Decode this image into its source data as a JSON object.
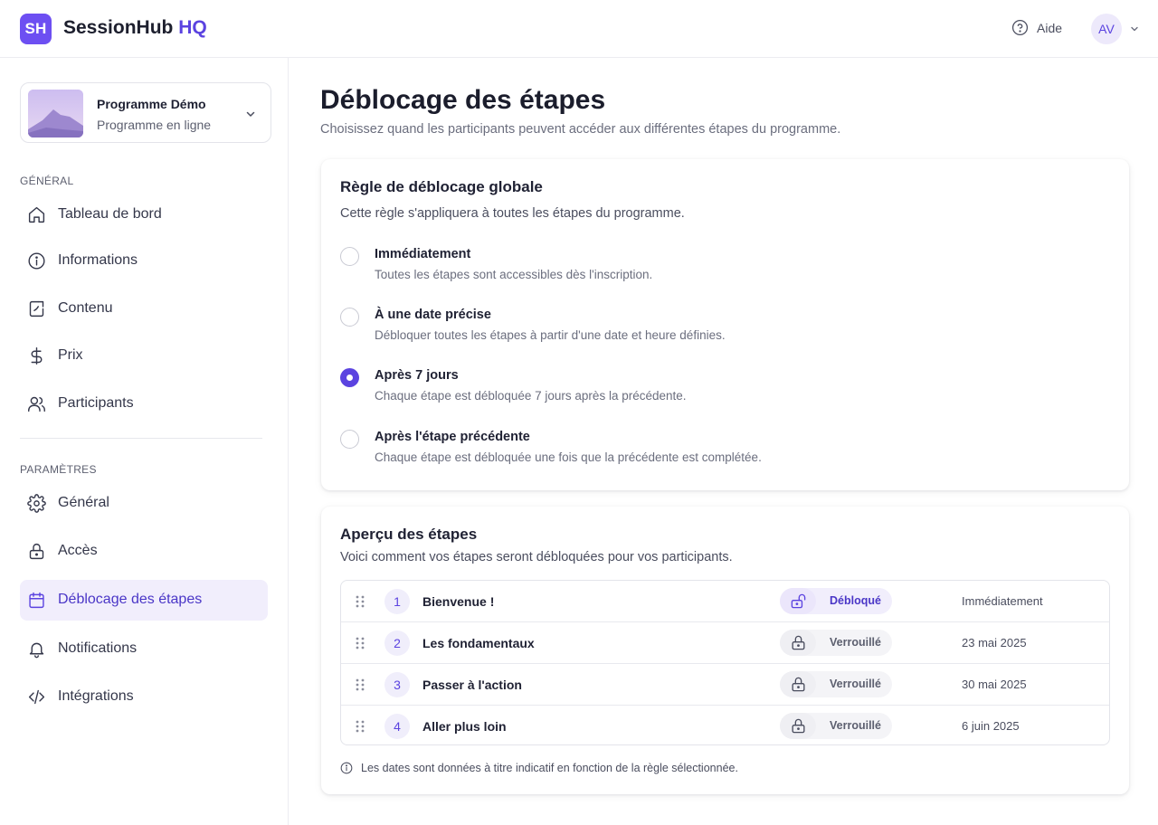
{
  "app": {
    "logo_mark": "SH",
    "name_main": "SessionHub",
    "name_accent": "HQ",
    "accent_color": "#5b43e0"
  },
  "header": {
    "help_label": "Aide",
    "help_icon": "help-circle-icon",
    "avatar_initials": "AV"
  },
  "sidebar": {
    "program": {
      "name": "Programme Démo",
      "subtitle": "Programme en ligne"
    },
    "general_section": "GÉNÉRAL",
    "general_items": [
      {
        "label": "Tableau de bord",
        "icon": "home-icon"
      },
      {
        "label": "Informations",
        "icon": "info-icon"
      },
      {
        "label": "Contenu",
        "icon": "content-icon"
      },
      {
        "label": "Prix",
        "icon": "dollar-icon"
      },
      {
        "label": "Participants",
        "icon": "users-icon"
      }
    ],
    "settings_section": "PARAMÈTRES",
    "settings_items": [
      {
        "label": "Général",
        "icon": "gear-icon"
      },
      {
        "label": "Accès",
        "icon": "lock-icon"
      },
      {
        "label": "Déblocage des étapes",
        "icon": "calendar-icon",
        "active": true
      },
      {
        "label": "Notifications",
        "icon": "bell-icon"
      },
      {
        "label": "Intégrations",
        "icon": "code-icon"
      }
    ]
  },
  "main": {
    "title": "Déblocage des étapes",
    "subtitle": "Choisissez quand les participants peuvent accéder aux différentes étapes du programme.",
    "rule_card": {
      "title": "Règle de déblocage globale",
      "subtitle": "Cette règle s'appliquera à toutes les étapes du programme.",
      "options": [
        {
          "title": "Immédiatement",
          "desc": "Toutes les étapes sont accessibles dès l'inscription.",
          "selected": false
        },
        {
          "title": "À une date précise",
          "desc": "Débloquer toutes les étapes à partir d'une date et heure définies.",
          "selected": false
        },
        {
          "title": "Après 7 jours",
          "desc": "Chaque étape est débloquée 7 jours après la précédente.",
          "selected": true
        },
        {
          "title": "Après l'étape précédente",
          "desc": "Chaque étape est débloquée une fois que la précédente est complétée.",
          "selected": false
        }
      ]
    },
    "preview_card": {
      "title": "Aperçu des étapes",
      "subtitle": "Voici comment vos étapes seront débloquées pour vos participants.",
      "stages": [
        {
          "number": "1",
          "name": "Bienvenue !",
          "status": "Débloqué",
          "unlocked": true,
          "date": "Immédiatement"
        },
        {
          "number": "2",
          "name": "Les fondamentaux",
          "status": "Verrouillé",
          "unlocked": false,
          "date": "23 mai 2025"
        },
        {
          "number": "3",
          "name": "Passer à l'action",
          "status": "Verrouillé",
          "unlocked": false,
          "date": "30 mai 2025"
        },
        {
          "number": "4",
          "name": "Aller plus loin",
          "status": "Verrouillé",
          "unlocked": false,
          "date": "6 juin 2025"
        }
      ],
      "footnote": "Les dates sont données à titre indicatif en fonction de la règle sélectionnée."
    }
  }
}
